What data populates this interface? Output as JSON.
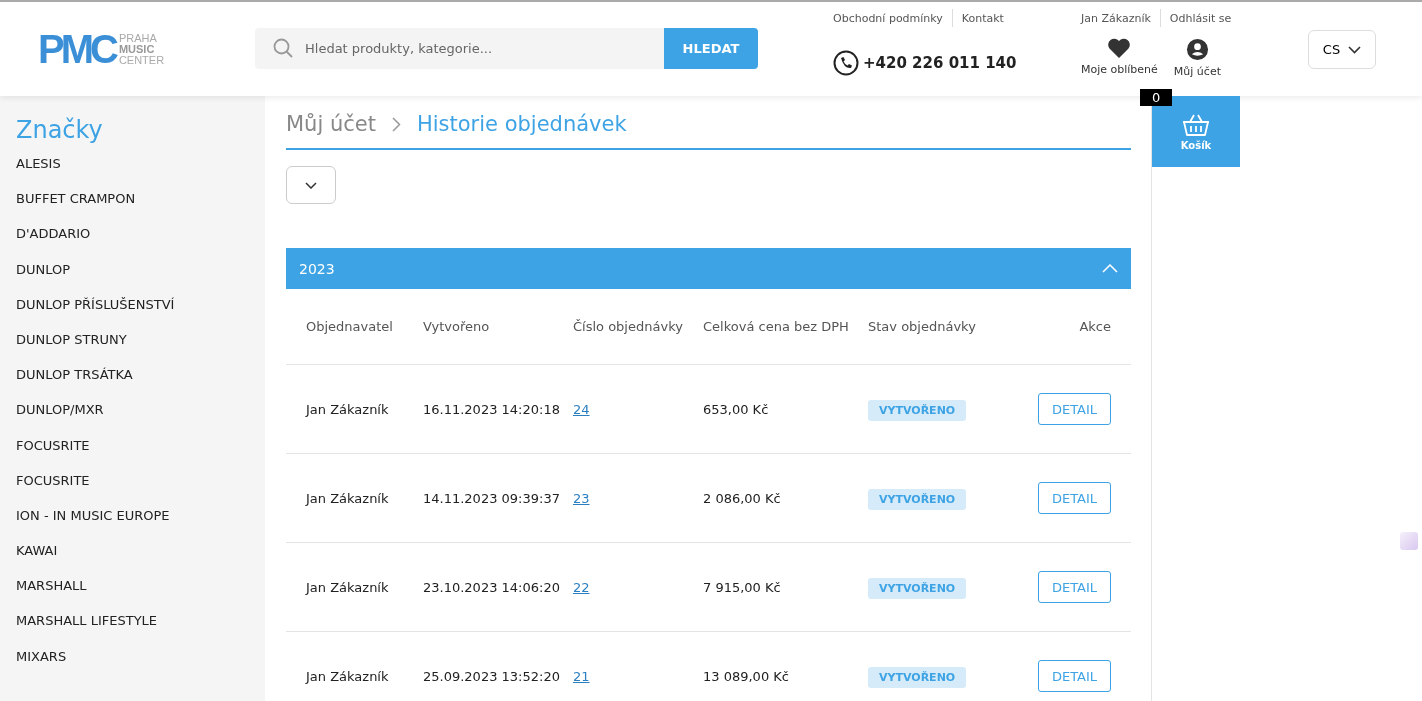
{
  "header": {
    "logo": {
      "mark": "PMC",
      "line_1": "PRAHA",
      "line_2": "MUSIC",
      "line_3": "CENTER"
    },
    "search": {
      "placeholder": "Hledat produkty, kategorie...",
      "button": "HLEDAT"
    },
    "top_links": [
      "Obchodní podmínky",
      "Kontakt"
    ],
    "phone": "+420 226 011 140",
    "user_links": [
      "Jan Zákazník",
      "Odhlásit se"
    ],
    "favorites": "Moje oblíbené",
    "account": "Můj účet",
    "language": "CS"
  },
  "cart": {
    "count": "0",
    "label": "Košík"
  },
  "sidebar": {
    "title": "Značky",
    "items": [
      "ALESIS",
      "BUFFET CRAMPON",
      "D'ADDARIO",
      "DUNLOP",
      "DUNLOP PŘÍSLUŠENSTVÍ",
      "DUNLOP STRUNY",
      "DUNLOP TRSÁTKA",
      "DUNLOP/MXR",
      "FOCUSRITE",
      "FOCUSRITE",
      "ION - IN MUSIC EUROPE",
      "KAWAI",
      "MARSHALL",
      "MARSHALL LIFESTYLE",
      "MIXARS"
    ]
  },
  "breadcrumb": [
    "Můj účet",
    "Historie objednávek"
  ],
  "year_group": {
    "year": "2023",
    "expanded": true
  },
  "table": {
    "columns": [
      "Objednavatel",
      "Vytvořeno",
      "Číslo objednávky",
      "Celková cena bez DPH",
      "Stav objednávky",
      "Akce"
    ],
    "rows": [
      {
        "customer": "Jan Zákazník",
        "created": "16.11.2023 14:20:18",
        "number": "24",
        "price": "653,00 Kč",
        "status": "VYTVOŘENO",
        "action": "DETAIL"
      },
      {
        "customer": "Jan Zákazník",
        "created": "14.11.2023 09:39:37",
        "number": "23",
        "price": "2 086,00 Kč",
        "status": "VYTVOŘENO",
        "action": "DETAIL"
      },
      {
        "customer": "Jan Zákazník",
        "created": "23.10.2023 14:06:20",
        "number": "22",
        "price": "7 915,00 Kč",
        "status": "VYTVOŘENO",
        "action": "DETAIL"
      },
      {
        "customer": "Jan Zákazník",
        "created": "25.09.2023 13:52:20",
        "number": "21",
        "price": "13 089,00 Kč",
        "status": "VYTVOŘENO",
        "action": "DETAIL"
      }
    ]
  }
}
